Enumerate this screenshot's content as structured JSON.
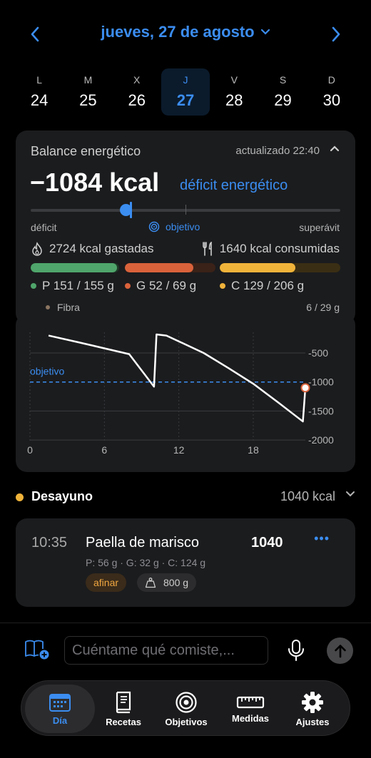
{
  "header": {
    "date_title": "jueves, 27 de agosto"
  },
  "week": [
    {
      "letter": "L",
      "num": "24"
    },
    {
      "letter": "M",
      "num": "25"
    },
    {
      "letter": "X",
      "num": "26"
    },
    {
      "letter": "J",
      "num": "27",
      "active": true
    },
    {
      "letter": "V",
      "num": "28"
    },
    {
      "letter": "S",
      "num": "29"
    },
    {
      "letter": "D",
      "num": "30"
    }
  ],
  "balance": {
    "title": "Balance energético",
    "updated": "actualizado 22:40",
    "value": "−1084 kcal",
    "status": "déficit energético",
    "label_deficit": "déficit",
    "label_goal": "objetivo",
    "label_surplus": "superávit",
    "spent": "2724 kcal gastadas",
    "consumed": "1640 kcal consumidas",
    "protein": "P 151 / 155 g",
    "fat": "G 52 / 69 g",
    "carbs": "C 129 / 206 g",
    "fiber_label": "Fibra",
    "fiber_value": "6 / 29 g",
    "protein_progress": 0.974,
    "fat_progress": 0.754,
    "carbs_progress": 0.626,
    "colors": {
      "protein": "#4fa56b",
      "fat": "#d9623b",
      "carbs": "#f0b33a",
      "accent": "#3b8df0"
    }
  },
  "chart_data": {
    "type": "line",
    "x_ticks": [
      "0",
      "6",
      "12",
      "18"
    ],
    "y_ticks": [
      "-500",
      "-1000",
      "-1500",
      "-2000"
    ],
    "goal_label": "objetivo",
    "goal_value": -1000,
    "series": [
      {
        "x": [
          1.5,
          4,
          6,
          8,
          10,
          10.2,
          11,
          12,
          14,
          16,
          18,
          20,
          22,
          22.2
        ],
        "y": [
          -200,
          -320,
          -420,
          -520,
          -1080,
          -180,
          -200,
          -300,
          -500,
          -760,
          -1030,
          -1350,
          -1680,
          -1100
        ]
      }
    ],
    "grid": true
  },
  "meal": {
    "name": "Desayuno",
    "kcal": "1040 kcal"
  },
  "entry": {
    "time": "10:35",
    "name": "Paella de marisco",
    "kcal": "1040",
    "macros": "P: 56 g · G: 32 g · C: 124 g",
    "tune_label": "afinar",
    "weight": "800 g"
  },
  "composer": {
    "placeholder": "Cuéntame qué comiste,..."
  },
  "tabs": [
    {
      "label": "Día",
      "active": true
    },
    {
      "label": "Recetas"
    },
    {
      "label": "Objetivos"
    },
    {
      "label": "Medidas"
    },
    {
      "label": "Ajustes"
    }
  ]
}
